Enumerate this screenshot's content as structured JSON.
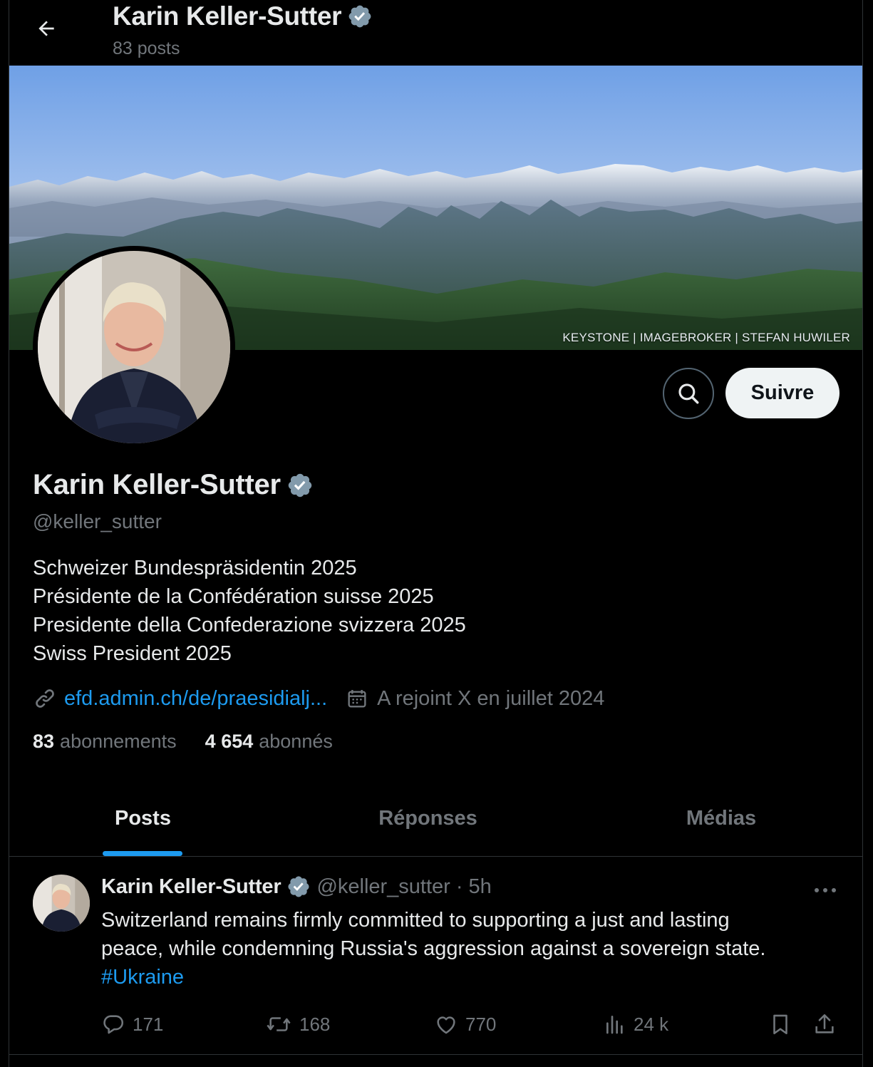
{
  "colors": {
    "background": "#000000",
    "text_primary": "#e7e9ea",
    "text_secondary": "#71767b",
    "accent": "#1d9bf0",
    "verified_badge": "#829aab",
    "follow_button_bg": "#eff3f4"
  },
  "header": {
    "back_icon": "arrow-left-icon",
    "title": "Karin Keller-Sutter",
    "post_count": "83 posts"
  },
  "banner": {
    "credit": "KEYSTONE | IMAGEBROKER | STEFAN HUWILER"
  },
  "actions": {
    "search_icon": "search-icon",
    "follow_label": "Suivre"
  },
  "profile": {
    "name": "Karin Keller-Sutter",
    "handle": "@keller_sutter",
    "bio": [
      "Schweizer Bundespräsidentin 2025",
      "Présidente de la Confédération suisse 2025",
      "Presidente della Confederazione svizzera 2025",
      "Swiss President 2025"
    ],
    "link": "efd.admin.ch/de/praesidialj...",
    "joined": "A rejoint X en juillet 2024",
    "following_count": "83",
    "following_label": "abonnements",
    "followers_count": "4 654",
    "followers_label": "abonnés"
  },
  "tabs": [
    {
      "label": "Posts",
      "active": true
    },
    {
      "label": "Réponses",
      "active": false
    },
    {
      "label": "Médias",
      "active": false
    }
  ],
  "post": {
    "author": "Karin Keller-Sutter",
    "handle": "@keller_sutter",
    "separator": "·",
    "time": "5h",
    "text_lines": [
      "Switzerland remains firmly committed to supporting a just and lasting",
      "peace, while condemning Russia's aggression against a sovereign state."
    ],
    "hashtag": "#Ukraine",
    "replies": "171",
    "reposts": "168",
    "likes": "770",
    "views": "24 k"
  }
}
